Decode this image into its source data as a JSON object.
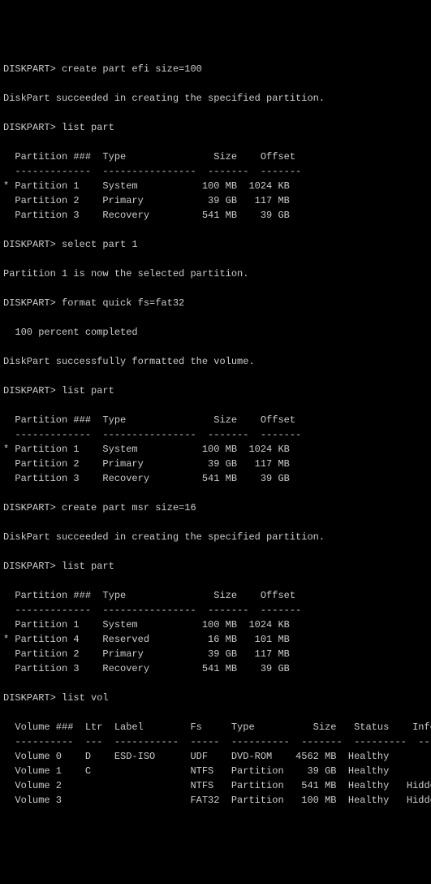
{
  "blocks": [
    {
      "type": "cmd",
      "prompt": "DISKPART>",
      "text": "create part efi size=100"
    },
    {
      "type": "blank"
    },
    {
      "type": "out",
      "text": "DiskPart succeeded in creating the specified partition."
    },
    {
      "type": "blank"
    },
    {
      "type": "cmd",
      "prompt": "DISKPART>",
      "text": "list part"
    },
    {
      "type": "blank"
    },
    {
      "type": "header",
      "cols": [
        "  Partition ###",
        "Type",
        "Size",
        "Offset"
      ]
    },
    {
      "type": "divider"
    },
    {
      "type": "partrow",
      "sel": "*",
      "name": "Partition 1",
      "ptype": "System",
      "size": "100 MB",
      "offset": "1024 KB"
    },
    {
      "type": "partrow",
      "sel": " ",
      "name": "Partition 2",
      "ptype": "Primary",
      "size": "39 GB",
      "offset": "117 MB"
    },
    {
      "type": "partrow",
      "sel": " ",
      "name": "Partition 3",
      "ptype": "Recovery",
      "size": "541 MB",
      "offset": "39 GB"
    },
    {
      "type": "blank"
    },
    {
      "type": "cmd",
      "prompt": "DISKPART>",
      "text": "select part 1"
    },
    {
      "type": "blank"
    },
    {
      "type": "out",
      "text": "Partition 1 is now the selected partition."
    },
    {
      "type": "blank"
    },
    {
      "type": "cmd",
      "prompt": "DISKPART>",
      "text": "format quick fs=fat32"
    },
    {
      "type": "blank"
    },
    {
      "type": "out",
      "text": "  100 percent completed"
    },
    {
      "type": "blank"
    },
    {
      "type": "out",
      "text": "DiskPart successfully formatted the volume."
    },
    {
      "type": "blank"
    },
    {
      "type": "cmd",
      "prompt": "DISKPART>",
      "text": "list part"
    },
    {
      "type": "blank"
    },
    {
      "type": "header",
      "cols": [
        "  Partition ###",
        "Type",
        "Size",
        "Offset"
      ]
    },
    {
      "type": "divider"
    },
    {
      "type": "partrow",
      "sel": "*",
      "name": "Partition 1",
      "ptype": "System",
      "size": "100 MB",
      "offset": "1024 KB"
    },
    {
      "type": "partrow",
      "sel": " ",
      "name": "Partition 2",
      "ptype": "Primary",
      "size": "39 GB",
      "offset": "117 MB"
    },
    {
      "type": "partrow",
      "sel": " ",
      "name": "Partition 3",
      "ptype": "Recovery",
      "size": "541 MB",
      "offset": "39 GB"
    },
    {
      "type": "blank"
    },
    {
      "type": "cmd",
      "prompt": "DISKPART>",
      "text": "create part msr size=16"
    },
    {
      "type": "blank"
    },
    {
      "type": "out",
      "text": "DiskPart succeeded in creating the specified partition."
    },
    {
      "type": "blank"
    },
    {
      "type": "cmd",
      "prompt": "DISKPART>",
      "text": "list part"
    },
    {
      "type": "blank"
    },
    {
      "type": "header",
      "cols": [
        "  Partition ###",
        "Type",
        "Size",
        "Offset"
      ]
    },
    {
      "type": "divider"
    },
    {
      "type": "partrow",
      "sel": " ",
      "name": "Partition 1",
      "ptype": "System",
      "size": "100 MB",
      "offset": "1024 KB"
    },
    {
      "type": "partrow",
      "sel": "*",
      "name": "Partition 4",
      "ptype": "Reserved",
      "size": "16 MB",
      "offset": "101 MB"
    },
    {
      "type": "partrow",
      "sel": " ",
      "name": "Partition 2",
      "ptype": "Primary",
      "size": "39 GB",
      "offset": "117 MB"
    },
    {
      "type": "partrow",
      "sel": " ",
      "name": "Partition 3",
      "ptype": "Recovery",
      "size": "541 MB",
      "offset": "39 GB"
    },
    {
      "type": "blank"
    },
    {
      "type": "cmd",
      "prompt": "DISKPART>",
      "text": "list vol"
    },
    {
      "type": "blank"
    },
    {
      "type": "volheader",
      "cols": [
        "  Volume ###",
        "Ltr",
        "Label",
        "Fs",
        "Type",
        "Size",
        "Status",
        "Info"
      ]
    },
    {
      "type": "voldivider"
    },
    {
      "type": "volrow",
      "name": "Volume 0",
      "ltr": "D",
      "label": "ESD-ISO",
      "fs": "UDF",
      "vtype": "DVD-ROM",
      "size": "4562 MB",
      "status": "Healthy",
      "info": ""
    },
    {
      "type": "volrow",
      "name": "Volume 1",
      "ltr": "C",
      "label": "",
      "fs": "NTFS",
      "vtype": "Partition",
      "size": "39 GB",
      "status": "Healthy",
      "info": ""
    },
    {
      "type": "volrow",
      "name": "Volume 2",
      "ltr": "",
      "label": "",
      "fs": "NTFS",
      "vtype": "Partition",
      "size": "541 MB",
      "status": "Healthy",
      "info": "Hidden"
    },
    {
      "type": "volrow",
      "name": "Volume 3",
      "ltr": "",
      "label": "",
      "fs": "FAT32",
      "vtype": "Partition",
      "size": "100 MB",
      "status": "Healthy",
      "info": "Hidden"
    }
  ]
}
